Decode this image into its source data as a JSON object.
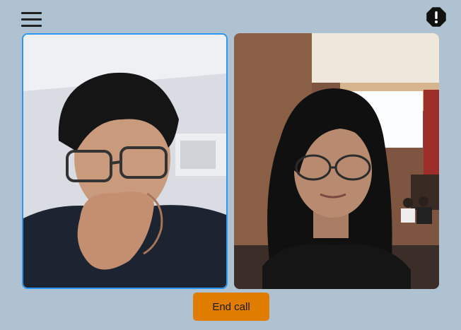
{
  "toolbar": {
    "menu_icon": "hamburger-menu-icon",
    "alert_icon": "exclamation-octagon-icon"
  },
  "videos": {
    "self": {
      "participant": "local",
      "active": true,
      "highlight_color": "#2d96ef"
    },
    "remote": {
      "participant": "remote",
      "active": false
    }
  },
  "controls": {
    "end_call_label": "End call",
    "end_call_color": "#e07c00"
  }
}
